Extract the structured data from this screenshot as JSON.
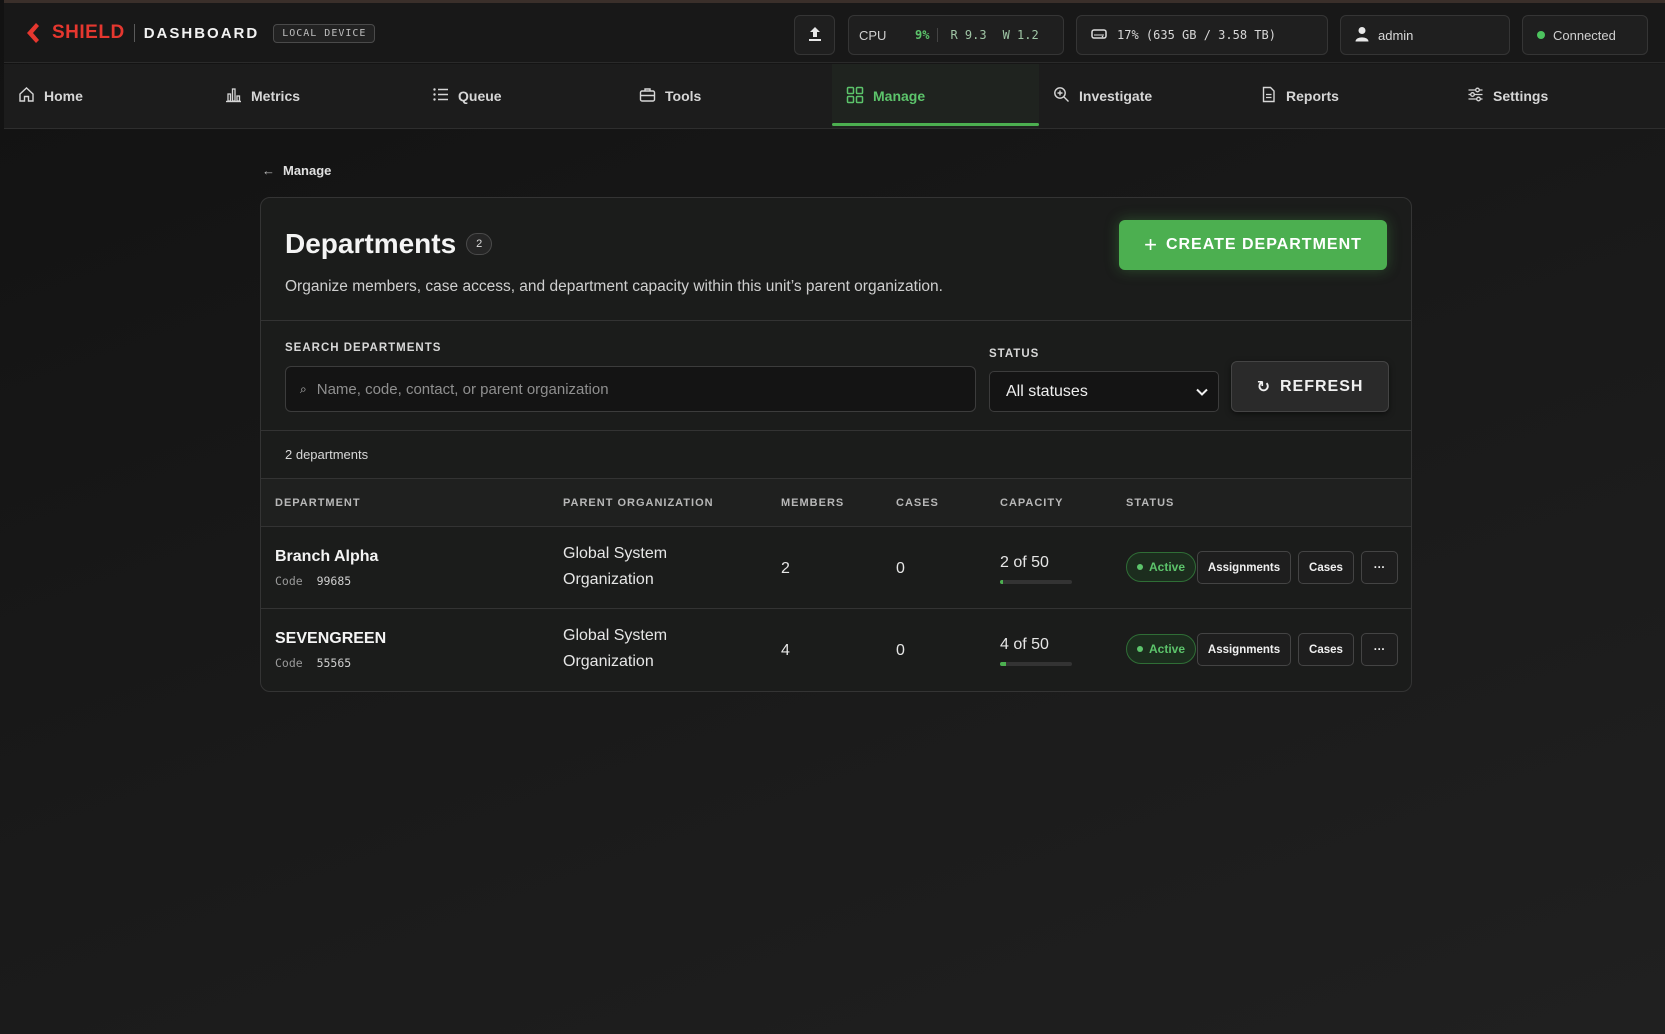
{
  "brand": {
    "name": "SHIELD",
    "product": "DASHBOARD",
    "mode_badge": "LOCAL DEVICE"
  },
  "topbar": {
    "cpu_label": "CPU",
    "cpu_percent": "9%",
    "read": "R 9.3",
    "write": "W 1.2",
    "disk": "17% (635 GB / 3.58 TB)",
    "user": "admin",
    "connection": "Connected"
  },
  "nav": {
    "items": [
      {
        "label": "Home",
        "icon": "home-icon"
      },
      {
        "label": "Metrics",
        "icon": "bar-chart-icon"
      },
      {
        "label": "Queue",
        "icon": "list-icon"
      },
      {
        "label": "Tools",
        "icon": "toolbox-icon"
      },
      {
        "label": "Manage",
        "icon": "grid-icon",
        "active": true
      },
      {
        "label": "Investigate",
        "icon": "zoom-in-icon"
      },
      {
        "label": "Reports",
        "icon": "document-icon"
      },
      {
        "label": "Settings",
        "icon": "sliders-icon"
      }
    ]
  },
  "breadcrumb": {
    "arrow": "←",
    "label": "Manage"
  },
  "page": {
    "title": "Departments",
    "count": "2",
    "subtitle": "Organize members, case access, and department capacity within this unit’s parent organization.",
    "create_button": "CREATE DEPARTMENT",
    "create_plus": "+"
  },
  "filters": {
    "search_label": "SEARCH DEPARTMENTS",
    "search_placeholder": "Name, code, contact, or parent organization",
    "search_icon_glyph": "⌕",
    "status_label": "STATUS",
    "status_value": "All statuses",
    "refresh_button": "REFRESH",
    "refresh_icon_glyph": "↻"
  },
  "results_count": "2 departments",
  "table": {
    "columns": [
      "DEPARTMENT",
      "PARENT ORGANIZATION",
      "MEMBERS",
      "CASES",
      "CAPACITY",
      "STATUS"
    ],
    "code_label": "Code",
    "rows": [
      {
        "name": "Branch Alpha",
        "code": "99685",
        "parent_org": "Global System Organization",
        "members": "2",
        "cases": "0",
        "capacity": "2 of 50",
        "capacity_fraction": 0.04,
        "status": "Active",
        "assignments_label": "Assignments",
        "cases_label": "Cases",
        "more_label": "···"
      },
      {
        "name": "SEVENGREEN",
        "code": "55565",
        "parent_org": "Global System Organization",
        "members": "4",
        "cases": "0",
        "capacity": "4 of 50",
        "capacity_fraction": 0.08,
        "status": "Active",
        "assignments_label": "Assignments",
        "cases_label": "Cases",
        "more_label": "···"
      }
    ]
  },
  "colors": {
    "accent": "#4caf50",
    "brand_red": "#e5372f",
    "status_green": "#5cc46b"
  }
}
